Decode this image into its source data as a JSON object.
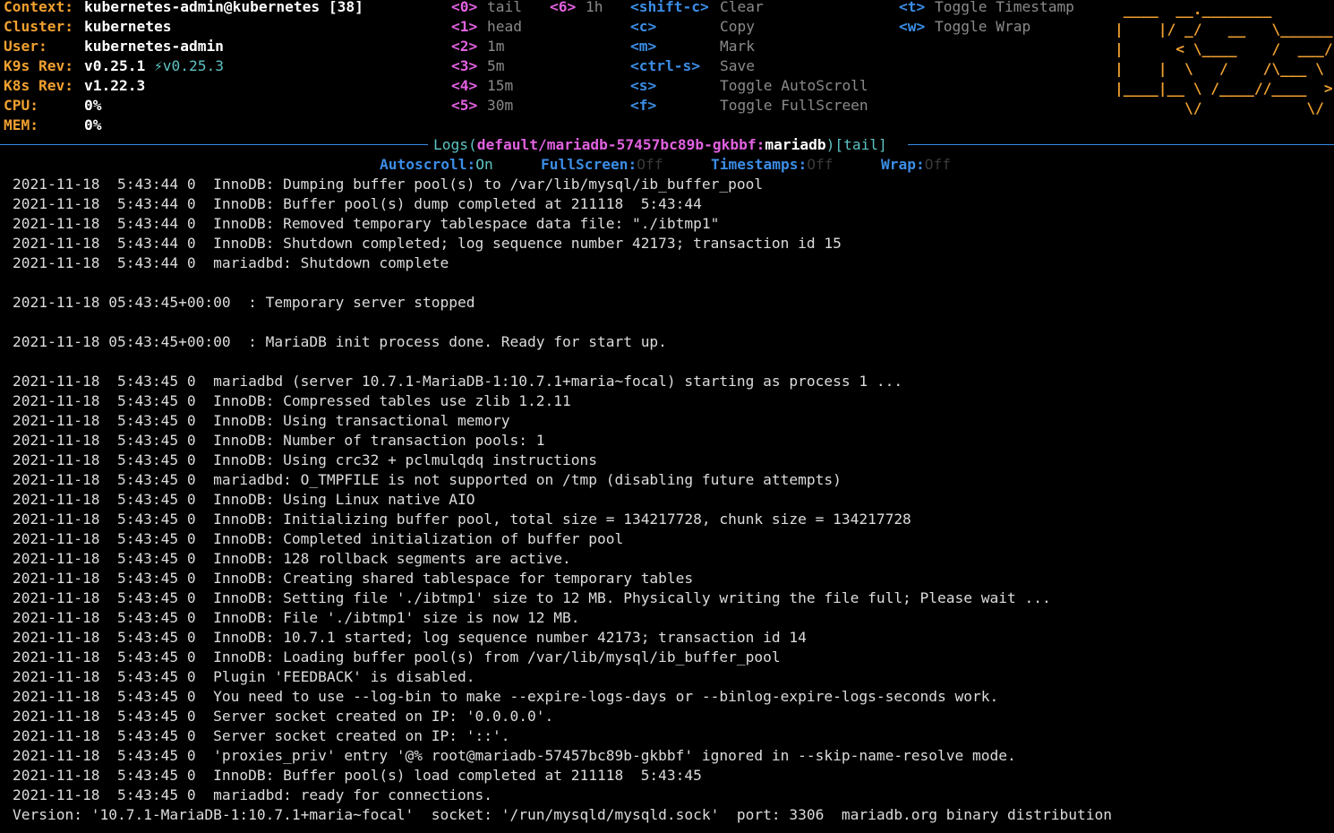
{
  "cluster_info": [
    {
      "key": "Context:",
      "value": "kubernetes-admin@kubernetes [38]"
    },
    {
      "key": "Cluster:",
      "value": "kubernetes"
    },
    {
      "key": "User:",
      "value": "kubernetes-admin"
    },
    {
      "key": "K9s Rev:",
      "value": "v0.25.1",
      "update": "⚡v0.25.3"
    },
    {
      "key": "K8s Rev:",
      "value": "v1.22.3"
    },
    {
      "key": "CPU:",
      "value": "0%"
    },
    {
      "key": "MEM:",
      "value": "0%"
    }
  ],
  "hotkeys_col1": [
    {
      "key": "<0>",
      "label": "tail"
    },
    {
      "key": "<1>",
      "label": "head"
    },
    {
      "key": "<2>",
      "label": "1m"
    },
    {
      "key": "<3>",
      "label": "5m"
    },
    {
      "key": "<4>",
      "label": "15m"
    },
    {
      "key": "<5>",
      "label": "30m"
    }
  ],
  "hotkeys_col2": [
    {
      "key": "<6>",
      "label": "1h"
    }
  ],
  "hotkeys_col3": [
    {
      "key": "<shift-c>",
      "label": "Clear"
    },
    {
      "key": "<c>",
      "label": "Copy"
    },
    {
      "key": "<m>",
      "label": "Mark"
    },
    {
      "key": "<ctrl-s>",
      "label": "Save"
    },
    {
      "key": "<s>",
      "label": "Toggle AutoScroll"
    },
    {
      "key": "<f>",
      "label": "Toggle FullScreen"
    }
  ],
  "hotkeys_col4": [
    {
      "key": "<t>",
      "label": "Toggle Timestamp"
    },
    {
      "key": "<w>",
      "label": "Toggle Wrap"
    }
  ],
  "logo_lines": [
    " ____  __.________        ",
    "|    |/ _/   __   \\______",
    "|      < \\____    /  ___/",
    "|    |  \\   /    /\\___ \\ ",
    "|____|__ \\ /____//____  >",
    "        \\/            \\/ "
  ],
  "title": {
    "prefix": "Logs(",
    "path": "default/mariadb-57457bc89b-gkbbf:",
    "container": "mariadb",
    "suffix": ")",
    "mode": "[tail]"
  },
  "status": [
    {
      "key": "Autoscroll:",
      "value": "On",
      "on": true
    },
    {
      "key": "FullScreen:",
      "value": "Off",
      "on": false
    },
    {
      "key": "Timestamps:",
      "value": "Off",
      "on": false
    },
    {
      "key": "Wrap:",
      "value": "Off",
      "on": false
    }
  ],
  "log_lines": [
    "2021-11-18  5:43:44 0  InnoDB: Dumping buffer pool(s) to /var/lib/mysql/ib_buffer_pool",
    "2021-11-18  5:43:44 0  InnoDB: Buffer pool(s) dump completed at 211118  5:43:44",
    "2021-11-18  5:43:44 0  InnoDB: Removed temporary tablespace data file: \"./ibtmp1\"",
    "2021-11-18  5:43:44 0  InnoDB: Shutdown completed; log sequence number 42173; transaction id 15",
    "2021-11-18  5:43:44 0  mariadbd: Shutdown complete",
    "",
    "2021-11-18 05:43:45+00:00  : Temporary server stopped",
    "",
    "2021-11-18 05:43:45+00:00  : MariaDB init process done. Ready for start up.",
    "",
    "2021-11-18  5:43:45 0  mariadbd (server 10.7.1-MariaDB-1:10.7.1+maria~focal) starting as process 1 ...",
    "2021-11-18  5:43:45 0  InnoDB: Compressed tables use zlib 1.2.11",
    "2021-11-18  5:43:45 0  InnoDB: Using transactional memory",
    "2021-11-18  5:43:45 0  InnoDB: Number of transaction pools: 1",
    "2021-11-18  5:43:45 0  InnoDB: Using crc32 + pclmulqdq instructions",
    "2021-11-18  5:43:45 0  mariadbd: O_TMPFILE is not supported on /tmp (disabling future attempts)",
    "2021-11-18  5:43:45 0  InnoDB: Using Linux native AIO",
    "2021-11-18  5:43:45 0  InnoDB: Initializing buffer pool, total size = 134217728, chunk size = 134217728",
    "2021-11-18  5:43:45 0  InnoDB: Completed initialization of buffer pool",
    "2021-11-18  5:43:45 0  InnoDB: 128 rollback segments are active.",
    "2021-11-18  5:43:45 0  InnoDB: Creating shared tablespace for temporary tables",
    "2021-11-18  5:43:45 0  InnoDB: Setting file './ibtmp1' size to 12 MB. Physically writing the file full; Please wait ...",
    "2021-11-18  5:43:45 0  InnoDB: File './ibtmp1' size is now 12 MB.",
    "2021-11-18  5:43:45 0  InnoDB: 10.7.1 started; log sequence number 42173; transaction id 14",
    "2021-11-18  5:43:45 0  InnoDB: Loading buffer pool(s) from /var/lib/mysql/ib_buffer_pool",
    "2021-11-18  5:43:45 0  Plugin 'FEEDBACK' is disabled.",
    "2021-11-18  5:43:45 0  You need to use --log-bin to make --expire-logs-days or --binlog-expire-logs-seconds work.",
    "2021-11-18  5:43:45 0  Server socket created on IP: '0.0.0.0'.",
    "2021-11-18  5:43:45 0  Server socket created on IP: '::'.",
    "2021-11-18  5:43:45 0  'proxies_priv' entry '@% root@mariadb-57457bc89b-gkbbf' ignored in --skip-name-resolve mode.",
    "2021-11-18  5:43:45 0  InnoDB: Buffer pool(s) load completed at 211118  5:43:45",
    "2021-11-18  5:43:45 0  mariadbd: ready for connections.",
    "Version: '10.7.1-MariaDB-1:10.7.1+maria~focal'  socket: '/run/mysqld/mysqld.sock'  port: 3306  mariadb.org binary distribution"
  ]
}
